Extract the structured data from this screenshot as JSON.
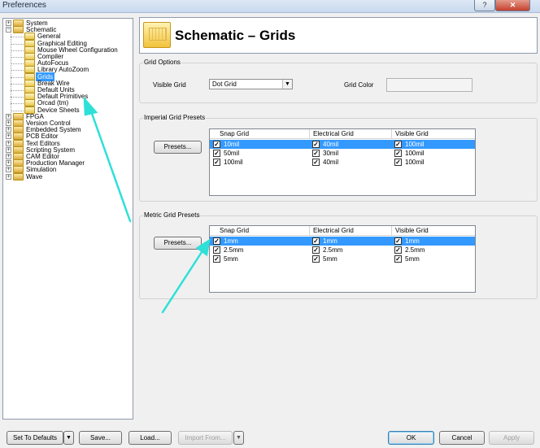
{
  "window": {
    "title": "Preferences",
    "help_btn": "?",
    "close_btn": "✕"
  },
  "tree": {
    "items": [
      {
        "label": "System",
        "level": 0,
        "expander": "+"
      },
      {
        "label": "Schematic",
        "level": 0,
        "expander": "−"
      },
      {
        "label": "General",
        "level": 1
      },
      {
        "label": "Graphical Editing",
        "level": 1
      },
      {
        "label": "Mouse Wheel Configuration",
        "level": 1
      },
      {
        "label": "Compiler",
        "level": 1
      },
      {
        "label": "AutoFocus",
        "level": 1
      },
      {
        "label": "Library AutoZoom",
        "level": 1
      },
      {
        "label": "Grids",
        "level": 1,
        "selected": true
      },
      {
        "label": "Break Wire",
        "level": 1
      },
      {
        "label": "Default Units",
        "level": 1
      },
      {
        "label": "Default Primitives",
        "level": 1
      },
      {
        "label": "Orcad (tm)",
        "level": 1
      },
      {
        "label": "Device Sheets",
        "level": 1
      },
      {
        "label": "FPGA",
        "level": 0,
        "expander": "+"
      },
      {
        "label": "Version Control",
        "level": 0,
        "expander": "+"
      },
      {
        "label": "Embedded System",
        "level": 0,
        "expander": "+"
      },
      {
        "label": "PCB Editor",
        "level": 0,
        "expander": "+"
      },
      {
        "label": "Text Editors",
        "level": 0,
        "expander": "+"
      },
      {
        "label": "Scripting System",
        "level": 0,
        "expander": "+"
      },
      {
        "label": "CAM Editor",
        "level": 0,
        "expander": "+"
      },
      {
        "label": "Production Manager",
        "level": 0,
        "expander": "+"
      },
      {
        "label": "Simulation",
        "level": 0,
        "expander": "+"
      },
      {
        "label": "Wave",
        "level": 0,
        "expander": "+"
      }
    ]
  },
  "header": {
    "title": "Schematic – Grids"
  },
  "grid_options": {
    "title": "Grid Options",
    "visible_grid_label": "Visible Grid",
    "visible_grid_value": "Dot Grid",
    "grid_color_label": "Grid Color"
  },
  "imperial": {
    "title": "Imperial Grid Presets",
    "presets_btn": "Presets...",
    "columns": [
      "Snap Grid",
      "Electrical Grid",
      "Visible Grid"
    ],
    "rows": [
      {
        "cells": [
          "10mil",
          "40mil",
          "100mil"
        ],
        "selected": true
      },
      {
        "cells": [
          "50mil",
          "30mil",
          "100mil"
        ],
        "selected": false
      },
      {
        "cells": [
          "100mil",
          "40mil",
          "100mil"
        ],
        "selected": false
      }
    ]
  },
  "metric": {
    "title": "Metric Grid Presets",
    "presets_btn": "Presets...",
    "columns": [
      "Snap Grid",
      "Electrical Grid",
      "Visible Grid"
    ],
    "rows": [
      {
        "cells": [
          "1mm",
          "1mm",
          "1mm"
        ],
        "selected": true
      },
      {
        "cells": [
          "2.5mm",
          "2.5mm",
          "2.5mm"
        ],
        "selected": false
      },
      {
        "cells": [
          "5mm",
          "5mm",
          "5mm"
        ],
        "selected": false
      }
    ]
  },
  "footer": {
    "set_defaults": "Set To Defaults",
    "save": "Save...",
    "load": "Load...",
    "import_from": "Import From...",
    "ok": "OK",
    "cancel": "Cancel",
    "apply": "Apply",
    "dropdown_arrow": "▼"
  },
  "check_mark": "✓",
  "colors": {
    "selection": "#3399ff",
    "annotation_arrow": "#2ee0d8"
  }
}
